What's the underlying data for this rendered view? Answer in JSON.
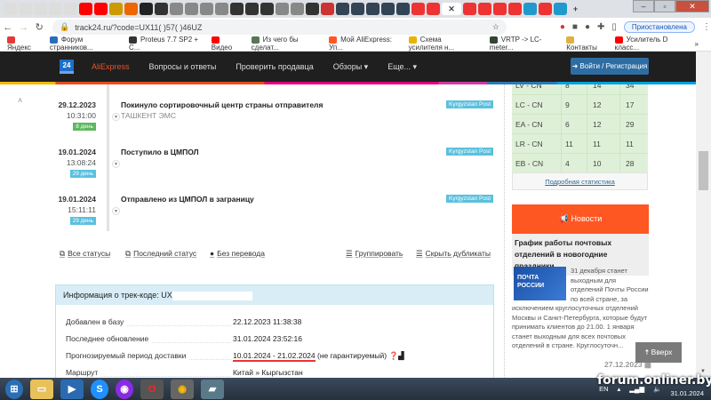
{
  "browser": {
    "tab_count": 37,
    "url": "track24.ru/?code=UX11(   )57(   )46UZ",
    "profile": "Приостановлена",
    "bookmarks": [
      "Яндекс",
      "Форум странников...",
      "Proteus 7.7 SP2 + C...",
      "Видео",
      "Из чего бы сделат...",
      "Мой AliExpress: Уп...",
      "Схема усилителя н...",
      "VRTP -> LC-meter...",
      "Контакты",
      "Усилитель D класс..."
    ],
    "bookmark_colors": [
      "#e53935",
      "#2a6ebb",
      "#333333",
      "#ff0000",
      "#557755",
      "#ff5722",
      "#e8b400",
      "#334433",
      "#e0b040",
      "#ff0000"
    ]
  },
  "header": {
    "logo": "24",
    "nav": [
      "AliExpress",
      "Вопросы и ответы",
      "Проверить продавца",
      "Обзоры ▾",
      "Еще... ▾"
    ],
    "login": "➜ Войти / Регистрация"
  },
  "events": [
    {
      "date": "29.12.2023",
      "time": "10:31:00",
      "badge": "8 день",
      "badge_color": "#5cb85c",
      "status": "Покинуло сортировочный центр страны отправителя",
      "location": "ТАШКЕНТ ЭМС",
      "provider": "Kyrgyzstan Post"
    },
    {
      "date": "19.01.2024",
      "time": "13:08:24",
      "badge": "29 день",
      "badge_color": "#5bc0de",
      "status": "Поступило в ЦМПОЛ",
      "location": "",
      "provider": "Kyrgyzstan Post"
    },
    {
      "date": "19.01.2024",
      "time": "15:11:11",
      "badge": "29 день",
      "badge_color": "#5bc0de",
      "status": "Отправлено из ЦМПОЛ в заграницу",
      "location": "",
      "provider": "Kyrgyzstan Post"
    }
  ],
  "links": [
    "Все статусы",
    "Последний статус",
    "Без перевода",
    "Группировать",
    "Скрыть дубликаты"
  ],
  "info": {
    "title": "Информация о трек-коде: UX",
    "rows": [
      {
        "k": "Добавлен в базу",
        "v": "22.12.2023 11:38:38"
      },
      {
        "k": "Последнее обновление",
        "v": "31.01.2024 23:52:16"
      },
      {
        "k": "Прогнозируемый период доставки",
        "v": "10.01.2024 - 21.02.2024",
        "note": "(не гарантируемый)"
      },
      {
        "k": "Маршрут",
        "v": "Китай » Кыргызстан"
      }
    ]
  },
  "stats": {
    "rows": [
      [
        "LV - CN",
        "8",
        "14",
        "34"
      ],
      [
        "LC - CN",
        "9",
        "12",
        "17"
      ],
      [
        "EA - CN",
        "6",
        "12",
        "29"
      ],
      [
        "LR - CN",
        "11",
        "11",
        "11"
      ],
      [
        "EB - CN",
        "4",
        "10",
        "28"
      ]
    ],
    "more": "Подробная статистика"
  },
  "news": {
    "header": "Новости",
    "title": "График работы почтовых отделений в новогодние праздники",
    "image_text": "ПОЧТА РОССИИ",
    "text": "31 декабря станет выходным для отделений Почты России по всей стране, за исключением круглосуточных отделений Москвы и Санкт-Петербурга, которые будут принимать клиентов до 21.00. 1 января станет выходным для всех почтовых отделений в стране. Круглосуточн...",
    "date": "27.12.2023",
    "up": "🠅 Вверх"
  },
  "taskbar": {
    "lang": "EN",
    "date": "31.01.2024",
    "watermark": "forum.onliner.by"
  }
}
